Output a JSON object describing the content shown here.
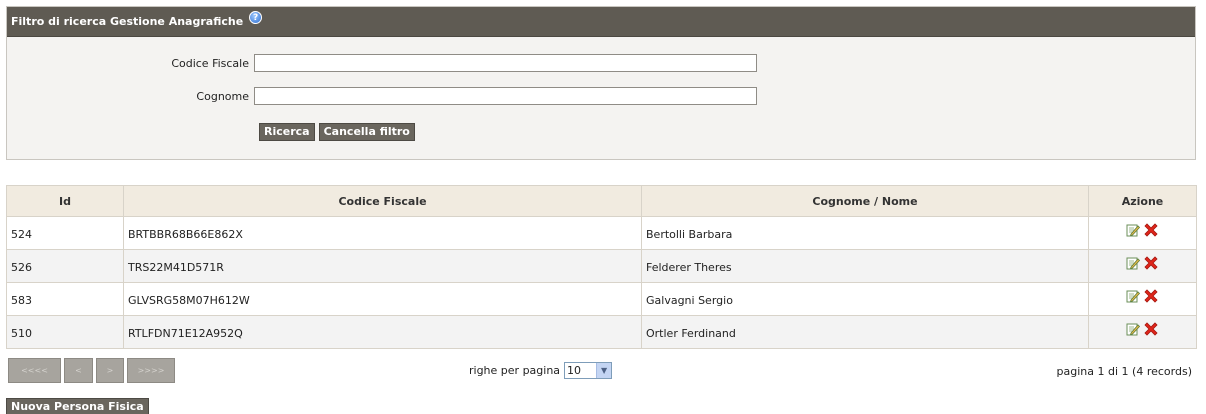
{
  "filter": {
    "title": "Filtro di ricerca Gestione Anagrafiche",
    "help_icon": "?",
    "fields": [
      {
        "label": "Codice Fiscale",
        "value": "",
        "placeholder": ""
      },
      {
        "label": "Cognome",
        "value": "",
        "placeholder": ""
      }
    ],
    "search_label": "Ricerca",
    "clear_label": "Cancella filtro"
  },
  "table": {
    "headers": [
      "Id",
      "Codice Fiscale",
      "Cognome / Nome",
      "Azione"
    ],
    "rows": [
      {
        "id": "524",
        "cf": "BRTBBR68B66E862X",
        "name": "Bertolli Barbara"
      },
      {
        "id": "526",
        "cf": "TRS22M41D571R",
        "name": "Felderer Theres"
      },
      {
        "id": "583",
        "cf": "GLVSRG58M07H612W",
        "name": "Galvagni Sergio"
      },
      {
        "id": "510",
        "cf": "RTLFDN71E12A952Q",
        "name": "Ortler Ferdinand"
      }
    ]
  },
  "pagination": {
    "first_label": "<<<<",
    "prev_label": "<",
    "next_label": ">",
    "last_label": ">>>>",
    "rows_label": "righe per pagina",
    "rows_value": "10",
    "page_info": "pagina 1 di 1 (4 records)"
  },
  "new_button_label": "Nuova Persona Fisica",
  "colors": {
    "header_bg": "#5f5b53",
    "button_bg": "#6a665e",
    "table_header_bg": "#f1ebe0",
    "delete_red": "#e0261b"
  }
}
